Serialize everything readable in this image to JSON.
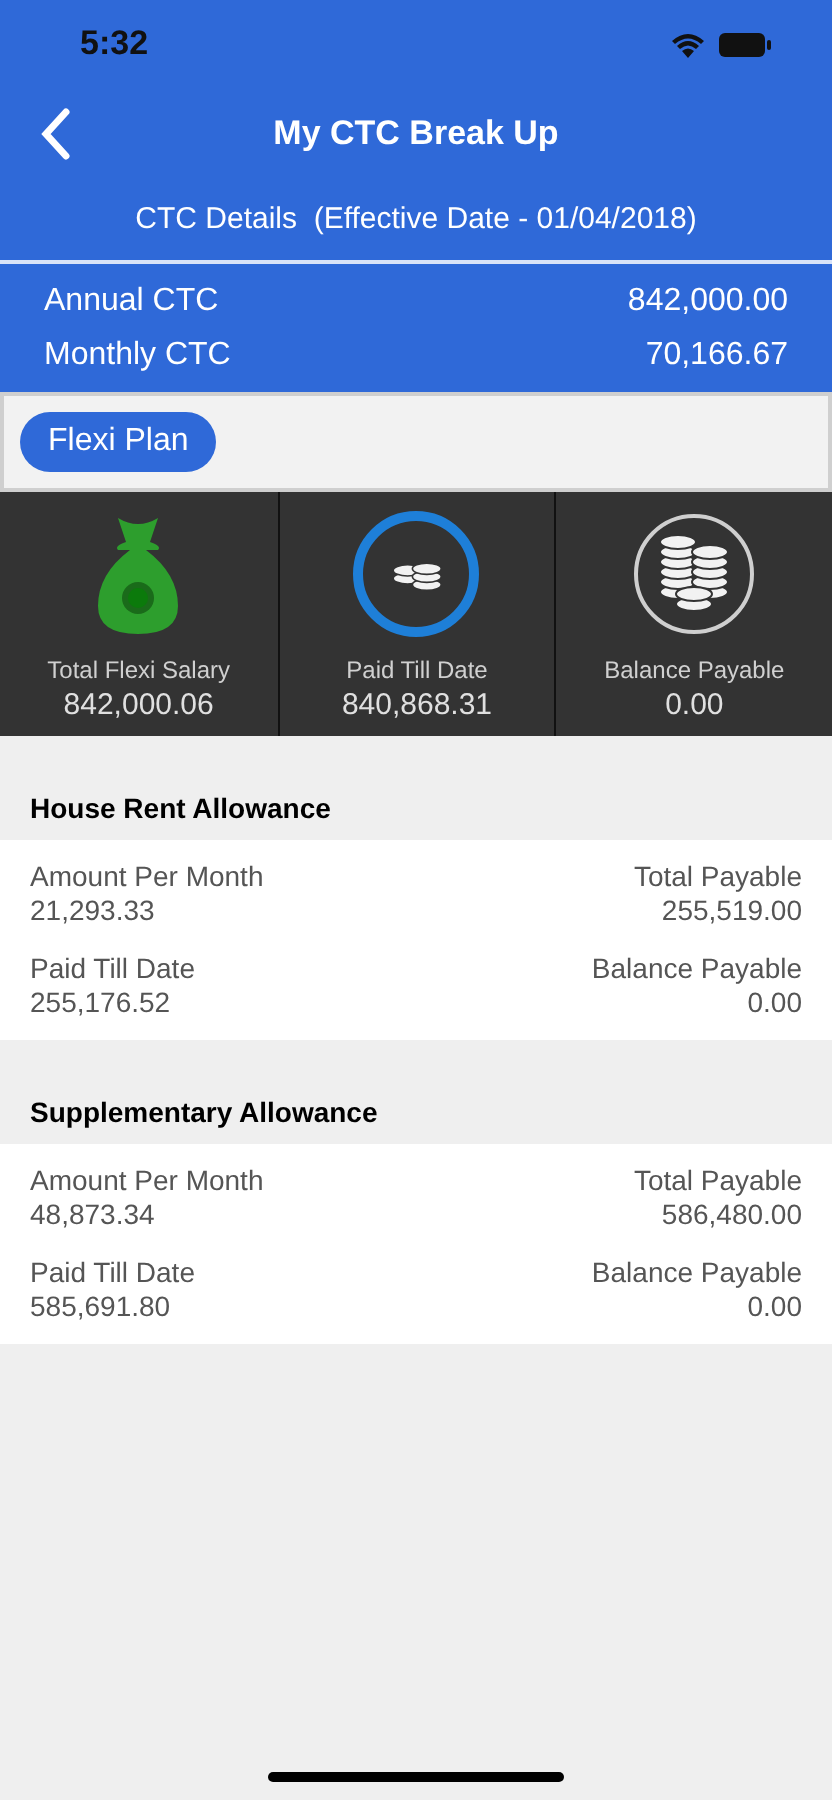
{
  "status_bar": {
    "time": "5:32"
  },
  "header": {
    "title": "My CTC Break Up"
  },
  "ctc_details": {
    "heading": "CTC Details  (Effective Date - 01/04/2018)",
    "rows": [
      {
        "label": "Annual CTC",
        "value": "842,000.00"
      },
      {
        "label": "Monthly CTC",
        "value": "70,166.67"
      }
    ]
  },
  "plan_tabs": [
    {
      "label": "Flexi Plan",
      "selected": true
    }
  ],
  "summary": [
    {
      "kind": "bag",
      "label": "Total Flexi Salary",
      "value": "842,000.06"
    },
    {
      "kind": "ring",
      "label": "Paid Till Date",
      "value": "840,868.31"
    },
    {
      "kind": "coins",
      "label": "Balance Payable",
      "value": "0.00"
    }
  ],
  "allowances": [
    {
      "title": "House Rent Allowance",
      "fields": [
        {
          "label": "Amount Per Month",
          "value": "21,293.33"
        },
        {
          "label": "Total Payable",
          "value": "255,519.00"
        },
        {
          "label": "Paid Till Date",
          "value": "255,176.52"
        },
        {
          "label": "Balance Payable",
          "value": "0.00"
        }
      ]
    },
    {
      "title": "Supplementary Allowance",
      "fields": [
        {
          "label": "Amount Per Month",
          "value": "48,873.34"
        },
        {
          "label": "Total Payable",
          "value": "586,480.00"
        },
        {
          "label": "Paid Till Date",
          "value": "585,691.80"
        },
        {
          "label": "Balance Payable",
          "value": "0.00"
        }
      ]
    }
  ]
}
